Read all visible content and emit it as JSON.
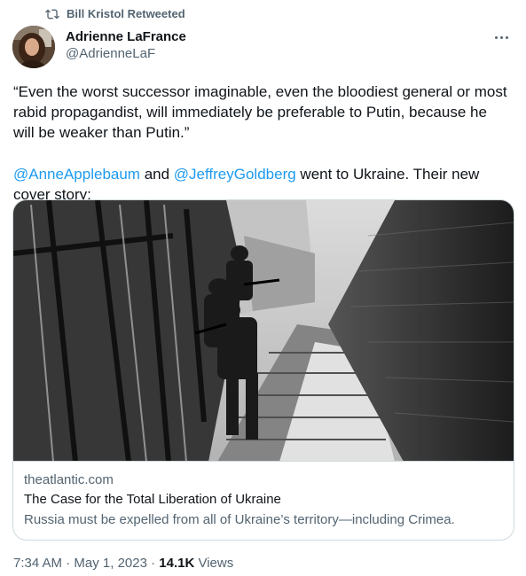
{
  "retweet": {
    "icon": "retweet-icon",
    "text": "Bill Kristol Retweeted"
  },
  "author": {
    "name": "Adrienne LaFrance",
    "handle": "@AdrienneLaF",
    "avatar_icon": "avatar-photo"
  },
  "more_icon": "more-icon",
  "tweet": {
    "quote": "“Even the worst successor imaginable, even the bloodiest general or most rabid propagandist, will immediately be preferable to Putin, because he will be weaker than Putin.”",
    "mention_1": "@AnneApplebaum",
    "connector": " and ",
    "mention_2": "@JeffreyGoldberg",
    "line_tail": " went to Ukraine. Their new cover story:"
  },
  "card": {
    "domain": "theatlantic.com",
    "title": "The Case for the Total Liberation of Ukraine",
    "description": "Russia must be expelled from all of Ukraine’s territory—including Crimea."
  },
  "meta": {
    "time": "7:34 AM",
    "separator": " · ",
    "date": "May 1, 2023",
    "views_count": "14.1K",
    "views_label": " Views"
  }
}
